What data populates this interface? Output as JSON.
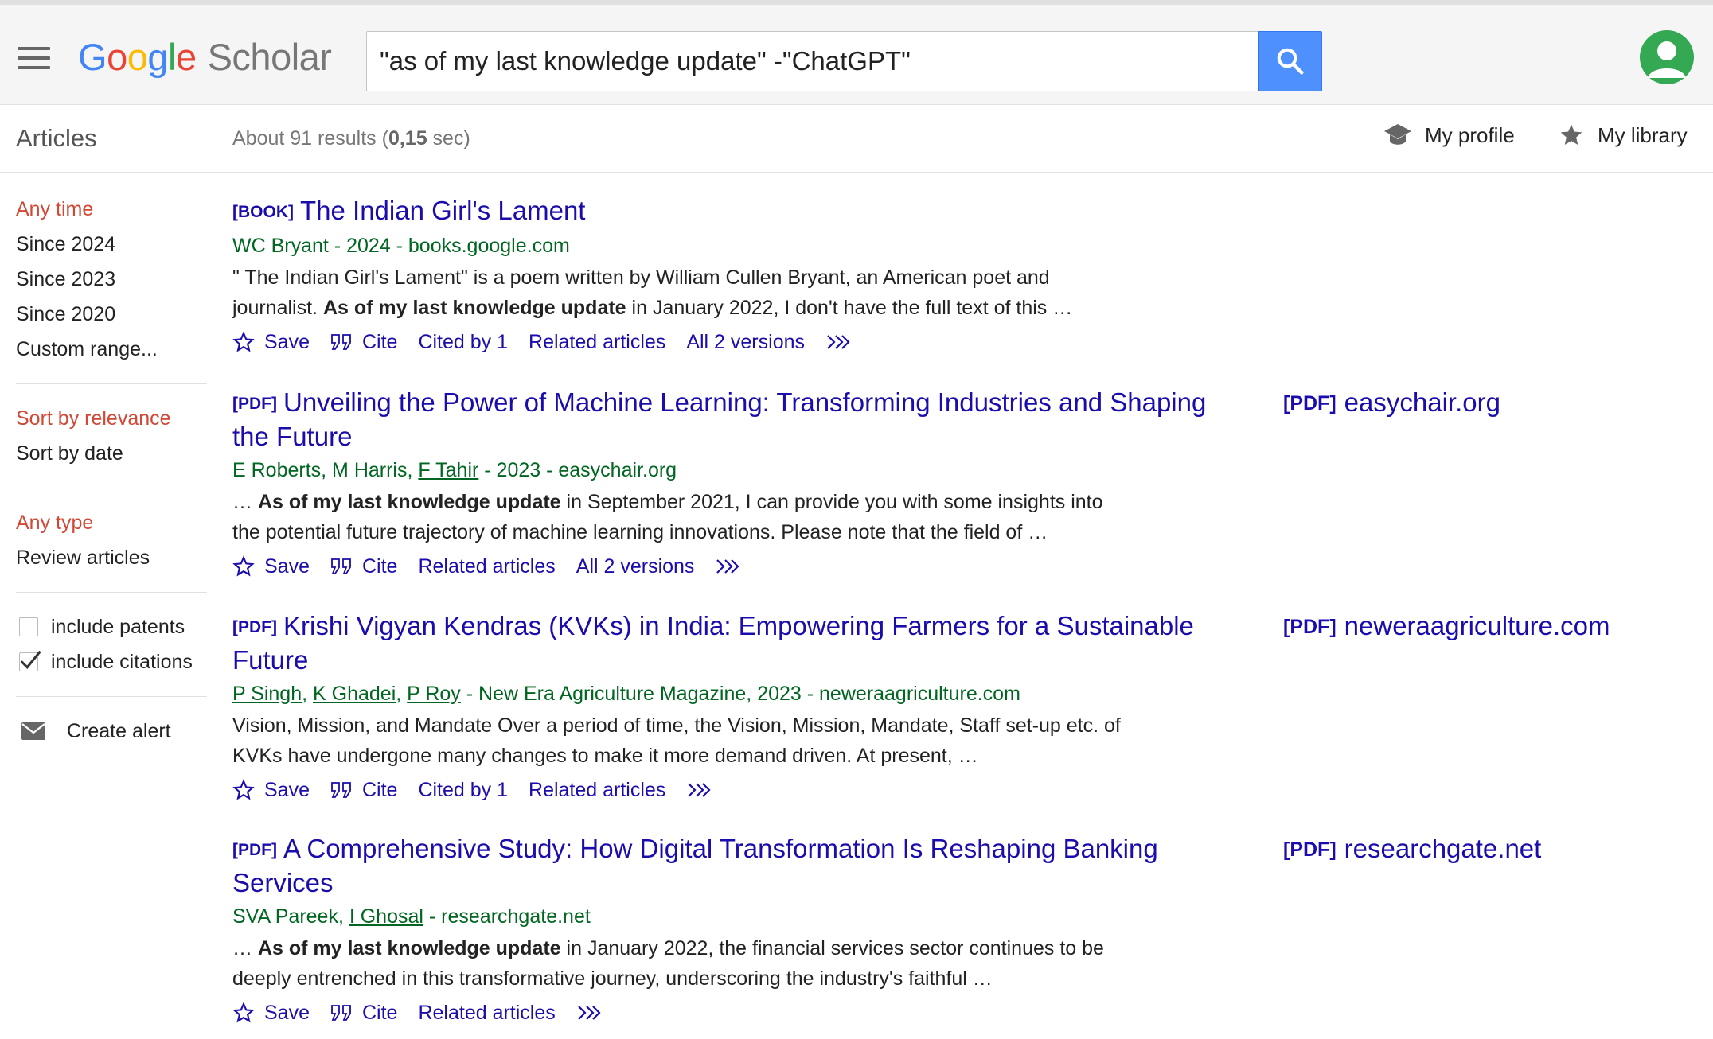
{
  "header": {
    "logo_google": [
      "G",
      "o",
      "o",
      "g",
      "l",
      "e"
    ],
    "logo_scholar": "Scholar",
    "search_value": "\"as of my last knowledge update\" -\"ChatGPT\""
  },
  "subheader": {
    "section_title": "Articles",
    "results_prefix": "About 91 results (",
    "results_time": "0,15",
    "results_suffix": " sec)",
    "my_profile": "My profile",
    "my_library": "My library"
  },
  "sidebar": {
    "time_filters": [
      "Any time",
      "Since 2024",
      "Since 2023",
      "Since 2020",
      "Custom range..."
    ],
    "sort_options": [
      "Sort by relevance",
      "Sort by date"
    ],
    "type_filters": [
      "Any type",
      "Review articles"
    ],
    "include_patents": "include patents",
    "include_citations": "include citations",
    "create_alert": "Create alert"
  },
  "results": [
    {
      "tag": "[BOOK]",
      "title": "The Indian Girl's Lament",
      "authors_plain": "WC Bryant - 2024 - books.google.com",
      "snippet_a": "\" The Indian Girl's Lament\" is a poem written by William Cullen Bryant, an American poet and journalist. ",
      "snippet_bold": "As of my last knowledge update",
      "snippet_b": " in January 2022, I don't have the full text of this …",
      "save": "Save",
      "cite": "Cite",
      "cited_by": "Cited by 1",
      "related": "Related articles",
      "versions": "All 2 versions"
    },
    {
      "tag": "[PDF]",
      "title": "Unveiling the Power of Machine Learning: Transforming Industries and Shaping the Future",
      "authors_pre": "E Roberts, M Harris, ",
      "author_link_1": "F Tahir",
      "authors_post": " - 2023 - easychair.org",
      "snippet_a": "… ",
      "snippet_bold": "As of my last knowledge update",
      "snippet_b": " in September 2021, I can provide you with some insights into the potential future trajectory of machine learning innovations. Please note that the field of …",
      "save": "Save",
      "cite": "Cite",
      "related": "Related articles",
      "versions": "All 2 versions",
      "side_tag": "[PDF]",
      "side_link": "easychair.org"
    },
    {
      "tag": "[PDF]",
      "title": "Krishi Vigyan Kendras (KVKs) in India: Empowering Farmers for a Sustainable Future",
      "author_link_1": "P Singh",
      "author_sep_1": ", ",
      "author_link_2": "K Ghadei",
      "author_sep_2": ", ",
      "author_link_3": "P Roy",
      "authors_post": " - New Era Agriculture Magazine, 2023 - neweraagriculture.com",
      "snippet": "Vision, Mission, and Mandate Over a period of time, the Vision, Mission, Mandate, Staff set-up etc. of KVKs have undergone many changes to make it more demand driven. At present, …",
      "save": "Save",
      "cite": "Cite",
      "cited_by": "Cited by 1",
      "related": "Related articles",
      "side_tag": "[PDF]",
      "side_link": "neweraagriculture.com"
    },
    {
      "tag": "[PDF]",
      "title": "A Comprehensive Study: How Digital Transformation Is Reshaping Banking Services",
      "authors_pre": "SVA Pareek, ",
      "author_link_1": "I Ghosal",
      "authors_post": " - researchgate.net",
      "snippet_a": "… ",
      "snippet_bold": "As of my last knowledge update",
      "snippet_b": " in January 2022, the financial services sector continues to be deeply entrenched in this transformative journey, underscoring the industry's faithful …",
      "save": "Save",
      "cite": "Cite",
      "related": "Related articles",
      "side_tag": "[PDF]",
      "side_link": "researchgate.net"
    }
  ]
}
